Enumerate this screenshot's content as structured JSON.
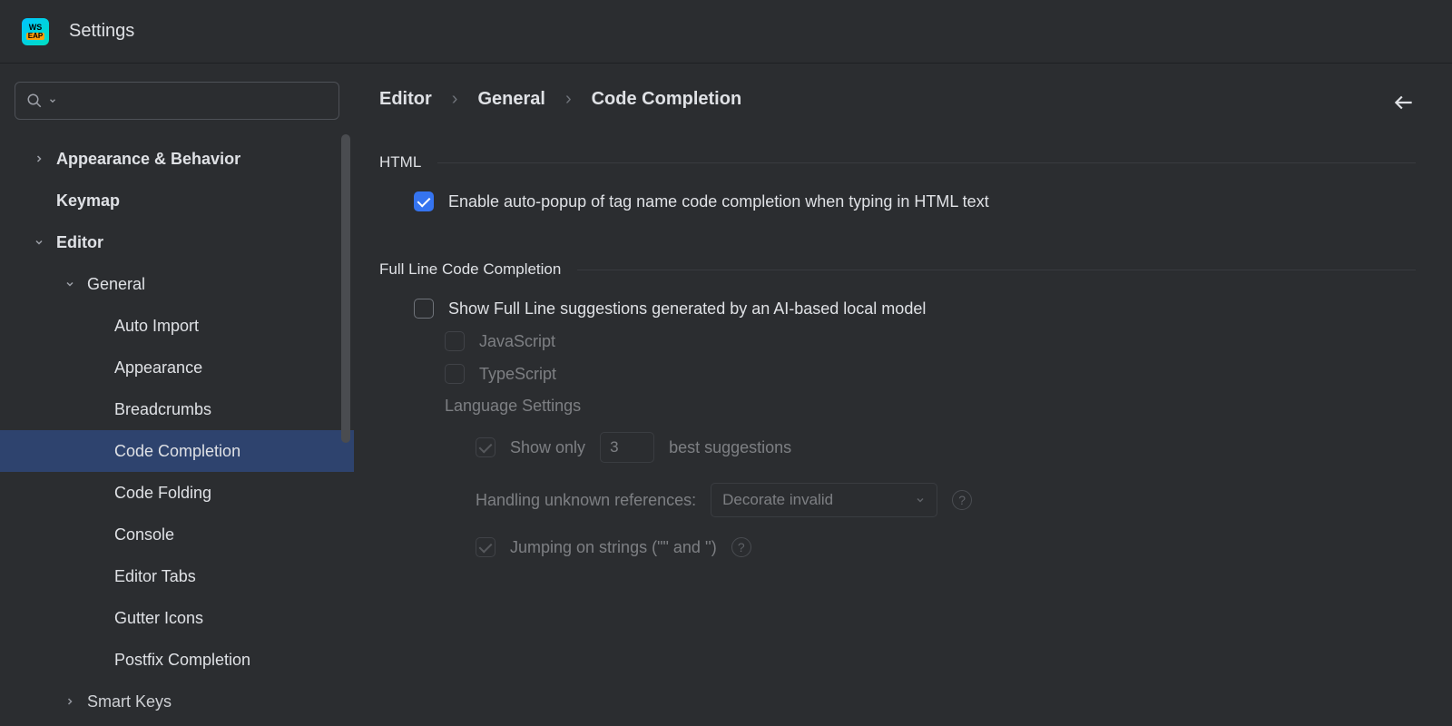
{
  "window": {
    "title": "Settings"
  },
  "search": {
    "placeholder": ""
  },
  "sidebar": {
    "items": [
      {
        "label": "Appearance & Behavior"
      },
      {
        "label": "Keymap"
      },
      {
        "label": "Editor"
      },
      {
        "label": "General"
      },
      {
        "label": "Auto Import"
      },
      {
        "label": "Appearance"
      },
      {
        "label": "Breadcrumbs"
      },
      {
        "label": "Code Completion"
      },
      {
        "label": "Code Folding"
      },
      {
        "label": "Console"
      },
      {
        "label": "Editor Tabs"
      },
      {
        "label": "Gutter Icons"
      },
      {
        "label": "Postfix Completion"
      },
      {
        "label": "Smart Keys"
      }
    ]
  },
  "breadcrumb": {
    "a": "Editor",
    "b": "General",
    "c": "Code Completion"
  },
  "sections": {
    "html": {
      "title": "HTML",
      "opt1": "Enable auto-popup of tag name code completion when typing in HTML text"
    },
    "fullline": {
      "title": "Full Line Code Completion",
      "opt1": "Show Full Line suggestions generated by an AI-based local model",
      "lang_js": "JavaScript",
      "lang_ts": "TypeScript",
      "lang_settings": "Language Settings",
      "show_only_pre": "Show only",
      "show_only_val": "3",
      "show_only_post": "best suggestions",
      "handling_label": "Handling unknown references:",
      "handling_value": "Decorate invalid",
      "jumping": "Jumping on strings (\"\" and '')"
    }
  }
}
